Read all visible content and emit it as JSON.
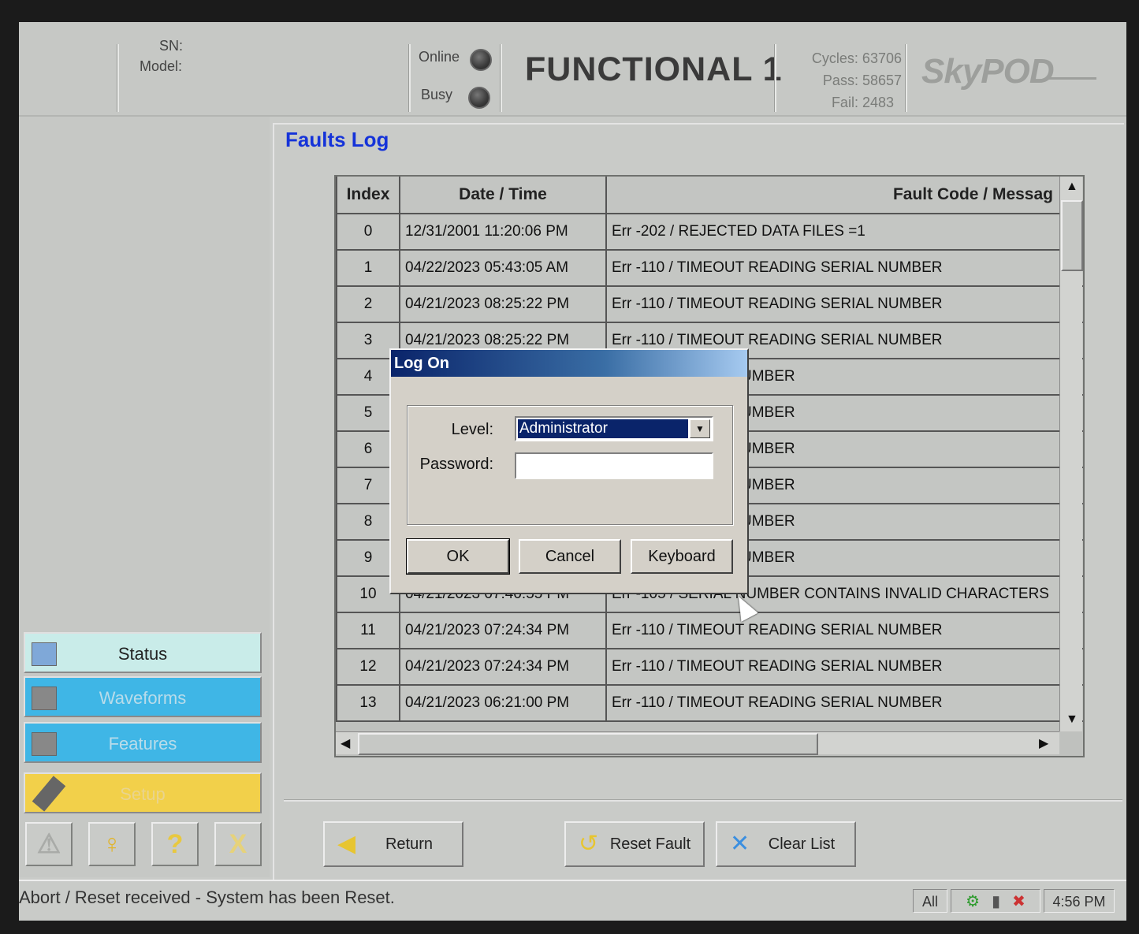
{
  "header": {
    "sn_label": "SN:",
    "model_label": "Model:",
    "online_label": "Online",
    "busy_label": "Busy",
    "mode_title": "FUNCTIONAL 1",
    "cycles": "Cycles: 63706",
    "pass": "Pass: 58657",
    "fail": "Fail: 2483",
    "logo": "SkyPOD"
  },
  "nav": {
    "status": "Status",
    "waveforms": "Waveforms",
    "features": "Features",
    "setup": "Setup",
    "colors": {
      "status": "#c9ece9",
      "waveforms": "#3fb6e6",
      "features": "#3fb6e6",
      "setup": "#f2d04a"
    }
  },
  "tools": [
    {
      "icon": "warning-icon",
      "glyph": "⚠"
    },
    {
      "icon": "key-icon",
      "glyph": "♀"
    },
    {
      "icon": "help-icon",
      "glyph": "?"
    },
    {
      "icon": "close-icon",
      "glyph": "X"
    }
  ],
  "page": {
    "title": "Faults Log"
  },
  "table": {
    "headers": {
      "index": "Index",
      "datetime": "Date / Time",
      "fault": "Fault Code / Messag"
    },
    "rows": [
      {
        "index": "0",
        "datetime": "12/31/2001 11:20:06 PM",
        "fault": "Err -202 /  REJECTED DATA FILES =1"
      },
      {
        "index": "1",
        "datetime": "04/22/2023 05:43:05 AM",
        "fault": "Err -110 / TIMEOUT READING SERIAL NUMBER"
      },
      {
        "index": "2",
        "datetime": "04/21/2023 08:25:22 PM",
        "fault": "Err -110 / TIMEOUT READING SERIAL NUMBER"
      },
      {
        "index": "3",
        "datetime": "04/21/2023 08:25:22 PM",
        "fault": "Err -110 / TIMEOUT READING SERIAL NUMBER"
      },
      {
        "index": "4",
        "datetime": "",
        "fault": "EADING SERIAL NUMBER"
      },
      {
        "index": "5",
        "datetime": "",
        "fault": "EADING SERIAL NUMBER"
      },
      {
        "index": "6",
        "datetime": "",
        "fault": "EADING SERIAL NUMBER"
      },
      {
        "index": "7",
        "datetime": "",
        "fault": "EADING SERIAL NUMBER"
      },
      {
        "index": "8",
        "datetime": "",
        "fault": "EADING SERIAL NUMBER"
      },
      {
        "index": "9",
        "datetime": "",
        "fault": "EADING SERIAL NUMBER"
      },
      {
        "index": "10",
        "datetime": "04/21/2023 07:40:55 PM",
        "fault": "Err -105 / SERIAL NUMBER CONTAINS INVALID CHARACTERS"
      },
      {
        "index": "11",
        "datetime": "04/21/2023 07:24:34 PM",
        "fault": "Err -110 / TIMEOUT READING SERIAL NUMBER"
      },
      {
        "index": "12",
        "datetime": "04/21/2023 07:24:34 PM",
        "fault": "Err -110 / TIMEOUT READING SERIAL NUMBER"
      },
      {
        "index": "13",
        "datetime": "04/21/2023 06:21:00 PM",
        "fault": "Err -110 / TIMEOUT READING SERIAL NUMBER"
      }
    ]
  },
  "buttons": {
    "return": "Return",
    "reset_fault": "Reset Fault",
    "clear_list": "Clear List"
  },
  "statusbar": {
    "message": "Abort / Reset received - System has been Reset.",
    "filter": "All",
    "time": "4:56 PM"
  },
  "dialog": {
    "title": "Log On",
    "level_label": "Level:",
    "level_value": "Administrator",
    "password_label": "Password:",
    "password_value": "",
    "ok": "OK",
    "cancel": "Cancel",
    "keyboard": "Keyboard"
  }
}
